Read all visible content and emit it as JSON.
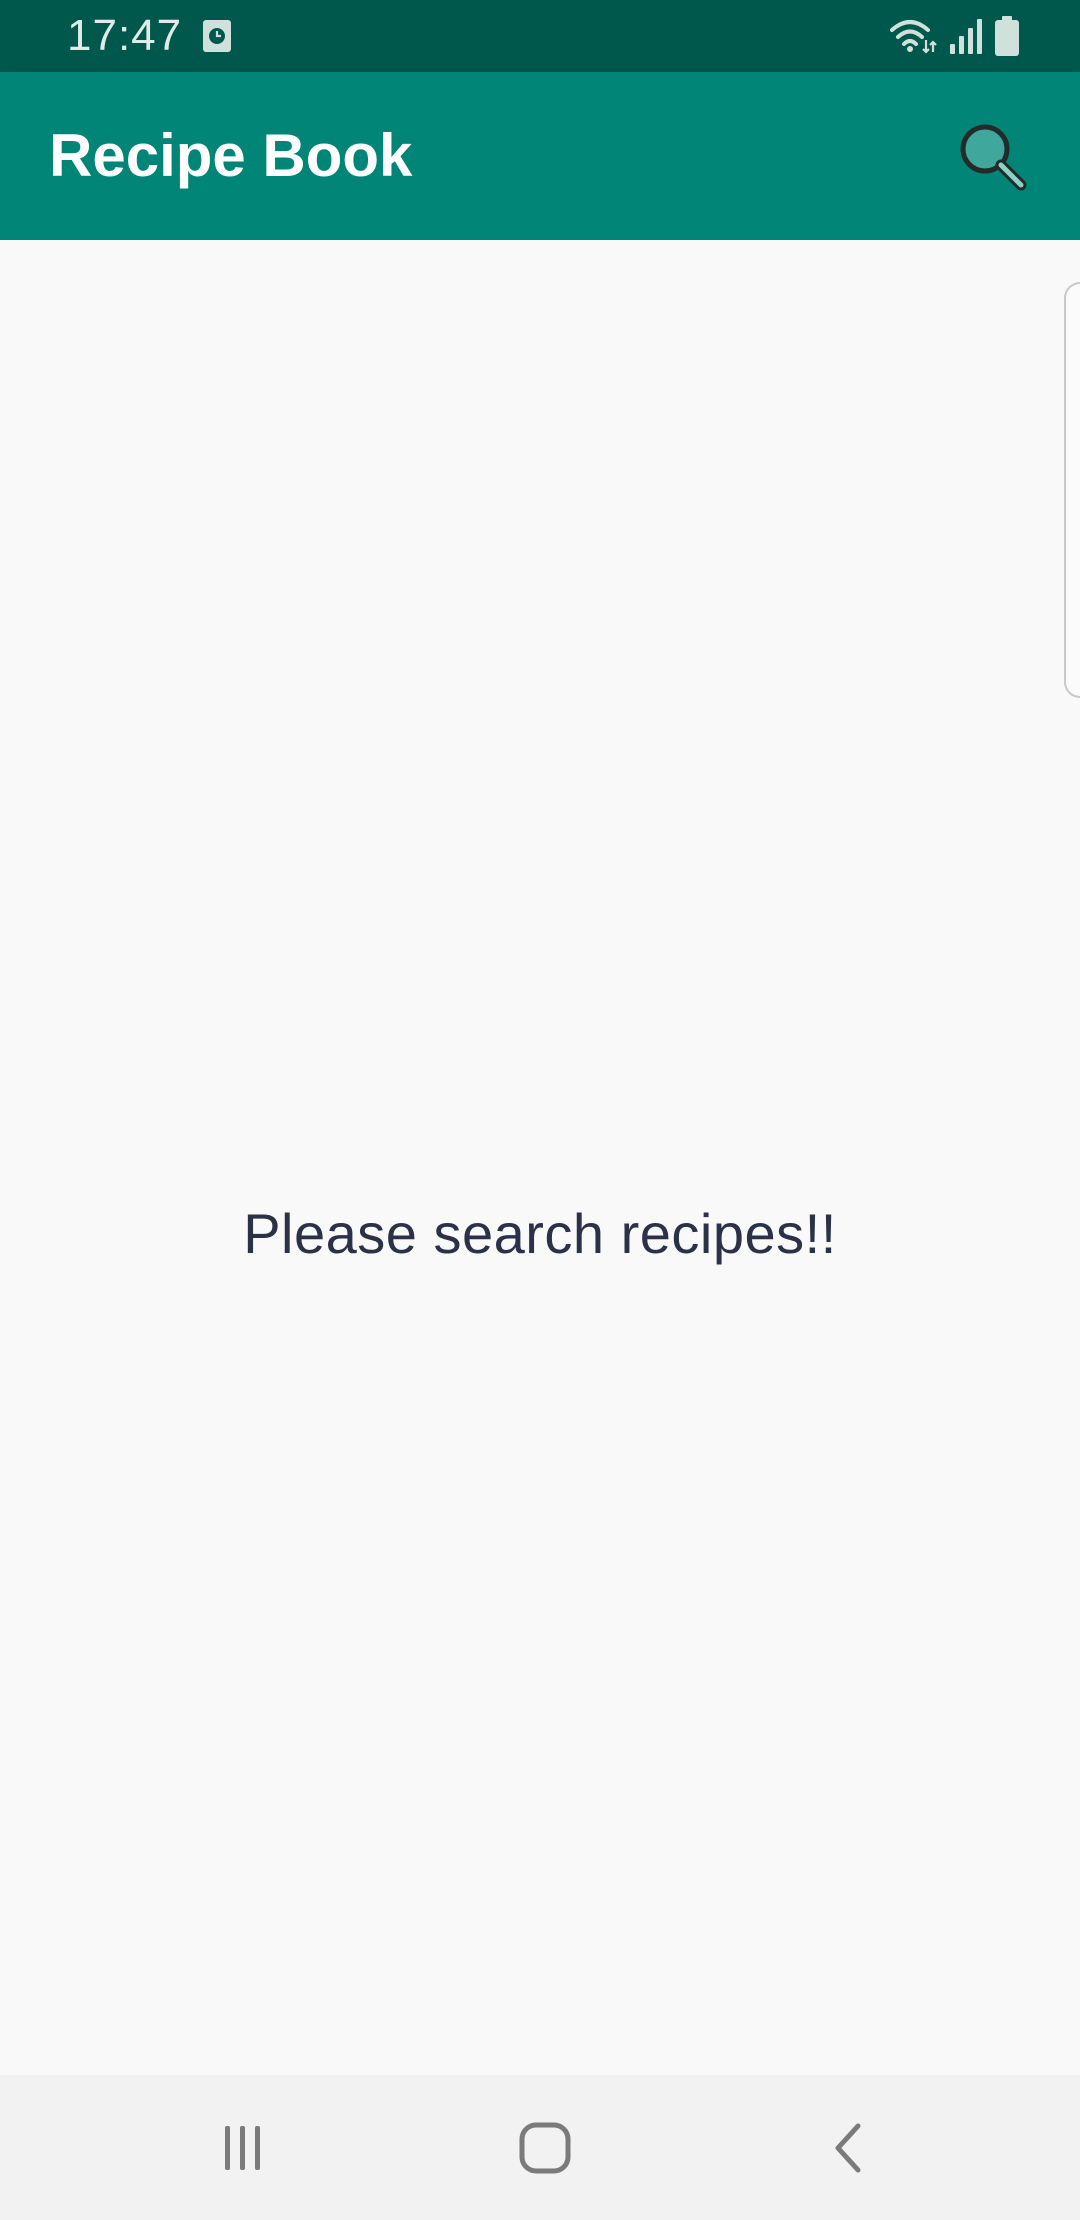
{
  "status_bar": {
    "time": "17:47",
    "icons": [
      "clock-notification-icon",
      "wifi-icon",
      "signal-icon",
      "battery-icon"
    ]
  },
  "app_bar": {
    "title": "Recipe Book",
    "search_icon": "search-icon"
  },
  "content": {
    "empty_message": "Please search recipes!!"
  },
  "nav_bar": {
    "buttons": [
      "recents-icon",
      "home-icon",
      "back-icon"
    ]
  },
  "colors": {
    "status_bar": "#00574b",
    "app_bar": "#018577",
    "background": "#f9f9f9",
    "message_text": "#2b3146",
    "nav_bar": "#f2f2f2"
  }
}
